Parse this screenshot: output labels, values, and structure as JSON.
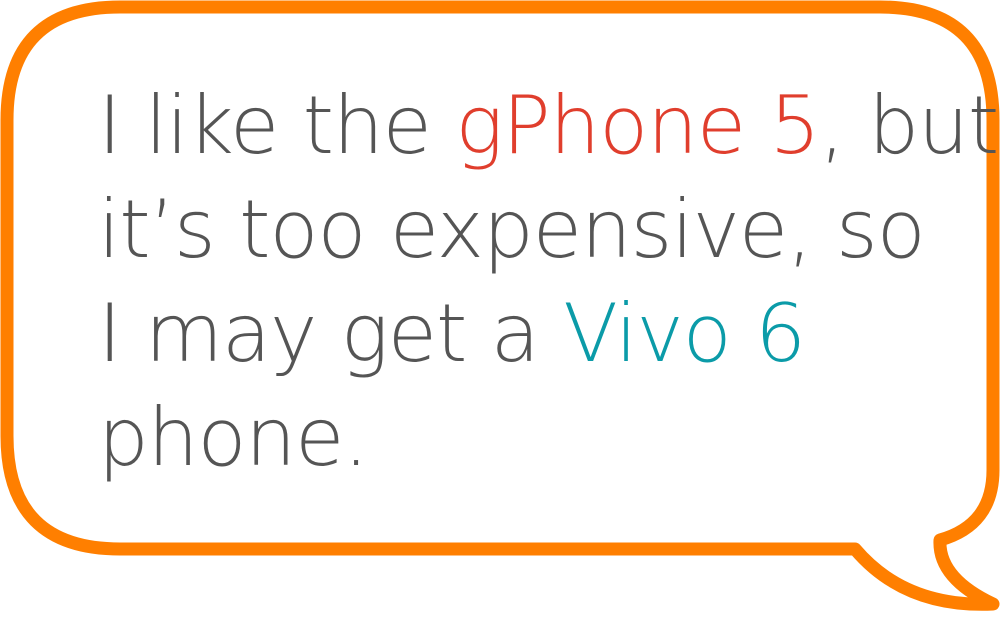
{
  "bubble": {
    "outline_color": "#FF7F00",
    "text_color": "#555555",
    "line1_before": "I like the ",
    "line1_highlight": "gPhone 5",
    "line1_highlight_color": "#E03E2D",
    "line1_after": ", but",
    "line2": "it’s too expensive, so",
    "line3_before": "I may get a ",
    "line3_highlight": "Vivo 6",
    "line3_highlight_color": "#0B9BA8",
    "line4": "phone."
  }
}
